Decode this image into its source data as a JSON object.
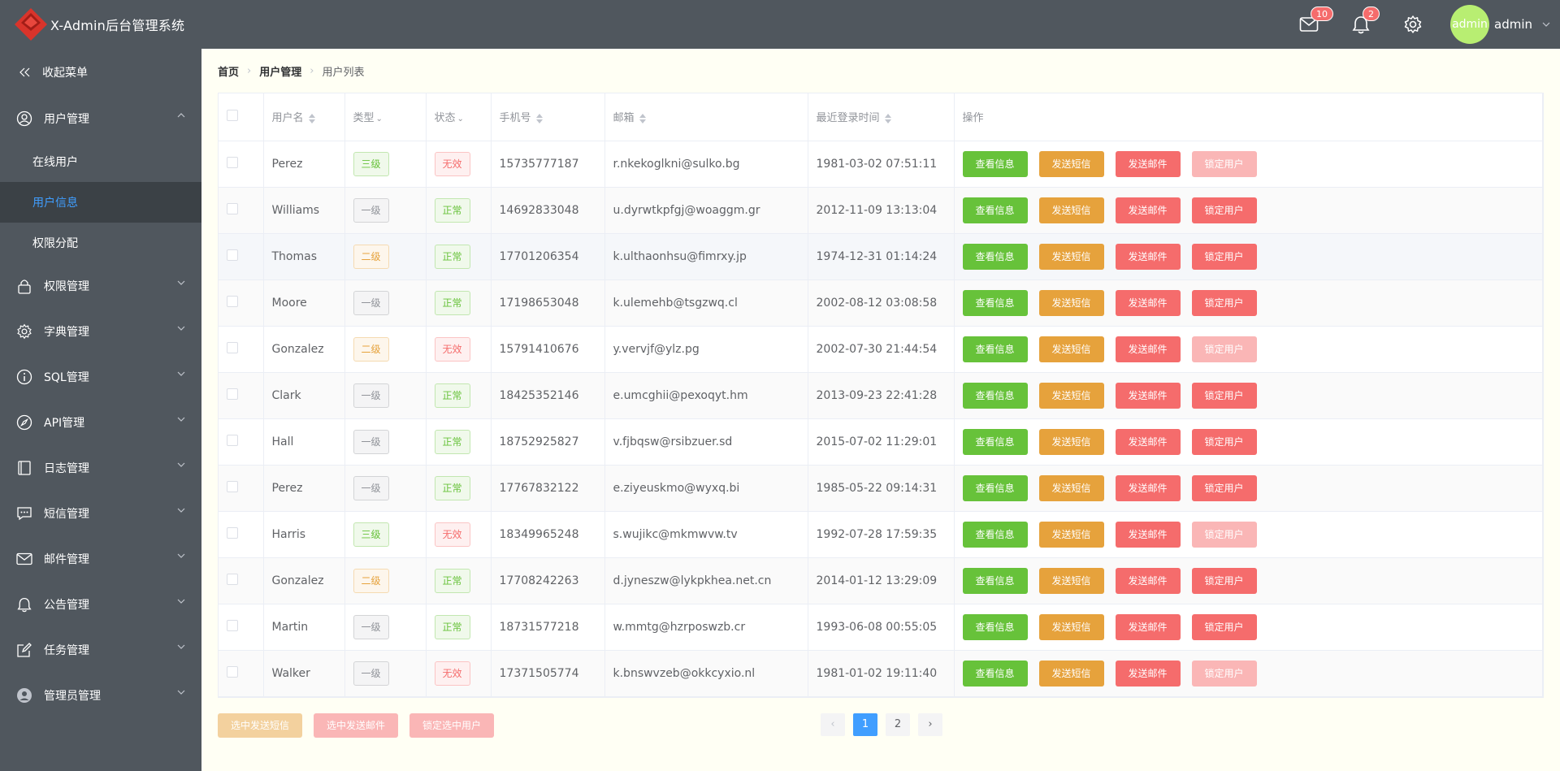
{
  "header": {
    "title": "X-Admin后台管理系统",
    "mail_badge": "10",
    "bell_badge": "2",
    "avatar_text": "admin",
    "user_name": "admin"
  },
  "sidebar": {
    "collapse_label": "收起菜单",
    "menus": [
      {
        "label": "用户管理",
        "icon": "user-icon",
        "expanded": true
      },
      {
        "label": "权限管理",
        "icon": "lock-icon"
      },
      {
        "label": "字典管理",
        "icon": "gear-icon"
      },
      {
        "label": "SQL管理",
        "icon": "info-icon"
      },
      {
        "label": "API管理",
        "icon": "compass-icon"
      },
      {
        "label": "日志管理",
        "icon": "notebook-icon"
      },
      {
        "label": "短信管理",
        "icon": "message-icon"
      },
      {
        "label": "邮件管理",
        "icon": "mail-icon"
      },
      {
        "label": "公告管理",
        "icon": "bell-icon"
      },
      {
        "label": "任务管理",
        "icon": "edit-icon"
      },
      {
        "label": "管理员管理",
        "icon": "avatar-icon"
      }
    ],
    "submenu": [
      {
        "label": "在线用户"
      },
      {
        "label": "用户信息",
        "active": true
      },
      {
        "label": "权限分配"
      }
    ]
  },
  "breadcrumb": [
    "首页",
    "用户管理",
    "用户列表"
  ],
  "table": {
    "headers": {
      "username": "用户名",
      "type": "类型",
      "status": "状态",
      "phone": "手机号",
      "email": "邮箱",
      "last_login": "最近登录时间",
      "actions": "操作"
    },
    "action_labels": {
      "view": "查看信息",
      "sms": "发送短信",
      "mail": "发送邮件",
      "lock": "锁定用户"
    },
    "rows": [
      {
        "name": "Perez",
        "type": "三级",
        "status": "无效",
        "phone": "15735777187",
        "email": "r.nkekoglkni@sulko.bg",
        "time": "1981-03-02 07:51:11"
      },
      {
        "name": "Williams",
        "type": "一级",
        "status": "正常",
        "phone": "14692833048",
        "email": "u.dyrwtkpfgj@woaggm.gr",
        "time": "2012-11-09 13:13:04"
      },
      {
        "name": "Thomas",
        "type": "二级",
        "status": "正常",
        "phone": "17701206354",
        "email": "k.ulthaonhsu@fimrxy.jp",
        "time": "1974-12-31 01:14:24"
      },
      {
        "name": "Moore",
        "type": "一级",
        "status": "正常",
        "phone": "17198653048",
        "email": "k.ulemehb@tsgzwq.cl",
        "time": "2002-08-12 03:08:58"
      },
      {
        "name": "Gonzalez",
        "type": "二级",
        "status": "无效",
        "phone": "15791410676",
        "email": "y.vervjf@ylz.pg",
        "time": "2002-07-30 21:44:54"
      },
      {
        "name": "Clark",
        "type": "一级",
        "status": "正常",
        "phone": "18425352146",
        "email": "e.umcghii@pexoqyt.hm",
        "time": "2013-09-23 22:41:28"
      },
      {
        "name": "Hall",
        "type": "一级",
        "status": "正常",
        "phone": "18752925827",
        "email": "v.fjbqsw@rsibzuer.sd",
        "time": "2015-07-02 11:29:01"
      },
      {
        "name": "Perez",
        "type": "一级",
        "status": "正常",
        "phone": "17767832122",
        "email": "e.ziyeuskmo@wyxq.bi",
        "time": "1985-05-22 09:14:31"
      },
      {
        "name": "Harris",
        "type": "三级",
        "status": "无效",
        "phone": "18349965248",
        "email": "s.wujikc@mkmwvw.tv",
        "time": "1992-07-28 17:59:35"
      },
      {
        "name": "Gonzalez",
        "type": "二级",
        "status": "正常",
        "phone": "17708242263",
        "email": "d.jyneszw@lykpkhea.net.cn",
        "time": "2014-01-12 13:29:09"
      },
      {
        "name": "Martin",
        "type": "一级",
        "status": "正常",
        "phone": "18731577218",
        "email": "w.mmtg@hzrposwzb.cr",
        "time": "1993-06-08 00:55:05"
      },
      {
        "name": "Walker",
        "type": "一级",
        "status": "无效",
        "phone": "17371505774",
        "email": "k.bnswvzeb@okkcyxio.nl",
        "time": "1981-01-02 19:11:40"
      }
    ]
  },
  "footer": {
    "batch_sms": "选中发送短信",
    "batch_mail": "选中发送邮件",
    "batch_lock": "锁定选中用户"
  },
  "pagination": {
    "pages": [
      "1",
      "2"
    ],
    "current": "1",
    "prev": "‹",
    "next": "›"
  },
  "colors": {
    "header_bg": "#50575e",
    "accent": "#409eff",
    "success": "#67c23a",
    "warning": "#e6a23c",
    "danger": "#f56c6c"
  }
}
